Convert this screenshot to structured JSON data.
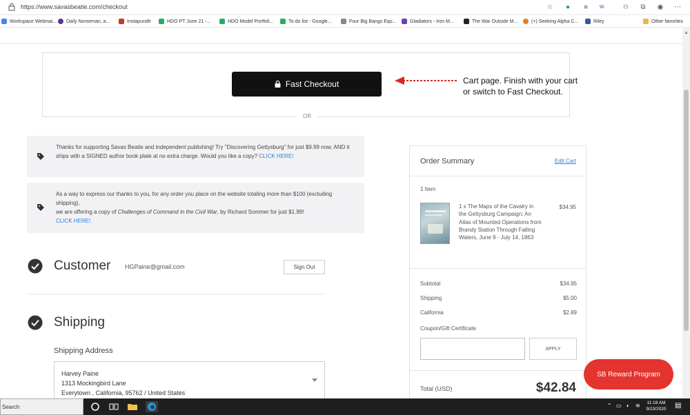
{
  "browser": {
    "url": "https://www.savasbeatie.com/checkout",
    "bookmarks": [
      {
        "label": "Workspace Webmai...",
        "color": "#4a86e8"
      },
      {
        "label": "Daily Norseman, a...",
        "color": "#5b3a8c"
      },
      {
        "label": "Instapundit",
        "color": "#c0392b"
      },
      {
        "label": "HDO PT June 21 -...",
        "color": "#27ae60"
      },
      {
        "label": "HDO Model Portfoli...",
        "color": "#27ae60"
      },
      {
        "label": "To-do list - Google...",
        "color": "#27ae60"
      },
      {
        "label": "Four Big Bangs Equ...",
        "color": "#888888"
      },
      {
        "label": "Gladiators - Iron M...",
        "color": "#6c3fb5"
      },
      {
        "label": "The War Outside M...",
        "color": "#222222"
      },
      {
        "label": "(+) Seeking Alpha C...",
        "color": "#e67e22"
      },
      {
        "label": "Riley",
        "color": "#3b5998"
      }
    ],
    "other_favorites": "Other favorites"
  },
  "checkout": {
    "fast_checkout_label": "Fast Checkout",
    "or_label": "OR",
    "annotation": "Cart page. Finish with your cart or switch to Fast Checkout."
  },
  "promos": [
    {
      "text": "Thanks for supporting Savas Beatie and independent publishing! Try \"Discovering Gettysburg\" for just $9.99 now, AND it ships with a SIGNED author book plate at no extra charge. Would you like a copy?",
      "link": "CLICK HERE!"
    },
    {
      "line1": "As a way to express our thanks to you, for any order you place on the website totaling more than $100 (excluding shipping),",
      "line2_pre": "we are offering a copy of",
      "line2_italic": "Challenges of Command in the Civil War",
      "line2_post": ", by Richard Sommer for just $1.99!",
      "link": "CLICK HERE!"
    }
  ],
  "customer": {
    "title": "Customer",
    "email": "HGPaine@gmail.com",
    "sign_out": "Sign Out"
  },
  "shipping": {
    "title": "Shipping",
    "address_label": "Shipping Address",
    "name": "Harvey Paine",
    "street": "1313 Mockingbird Lane",
    "city_line": "Everytown , California, 95762 / United States"
  },
  "summary": {
    "title": "Order Summary",
    "edit": "Edit Cart",
    "item_count": "1 Item",
    "item_title": "1 x The Maps of the Cavalry in the Gettysburg Campaign: An Atlas of Mounted Operations from Brandy Station Through Falling Waters, June 9 - July 14, 1863",
    "item_price": "$34.95",
    "rows": [
      {
        "label": "Subtotal",
        "value": "$34.95"
      },
      {
        "label": "Shipping",
        "value": "$5.00"
      },
      {
        "label": "California",
        "value": "$2.89"
      }
    ],
    "coupon_label": "Coupon/Gift Certificate",
    "coupon_value": "",
    "apply": "APPLY",
    "total_label": "Total (USD)",
    "total_value": "$42.84"
  },
  "reward_button": "SB Reward Program",
  "taskbar": {
    "search": "Search",
    "time": "11:18 AM",
    "date": "9/23/2020"
  },
  "colors": {
    "accent_link": "#2b7fd4",
    "reward": "#e3342f",
    "fast_checkout": "#111111",
    "arrow": "#d62828"
  }
}
